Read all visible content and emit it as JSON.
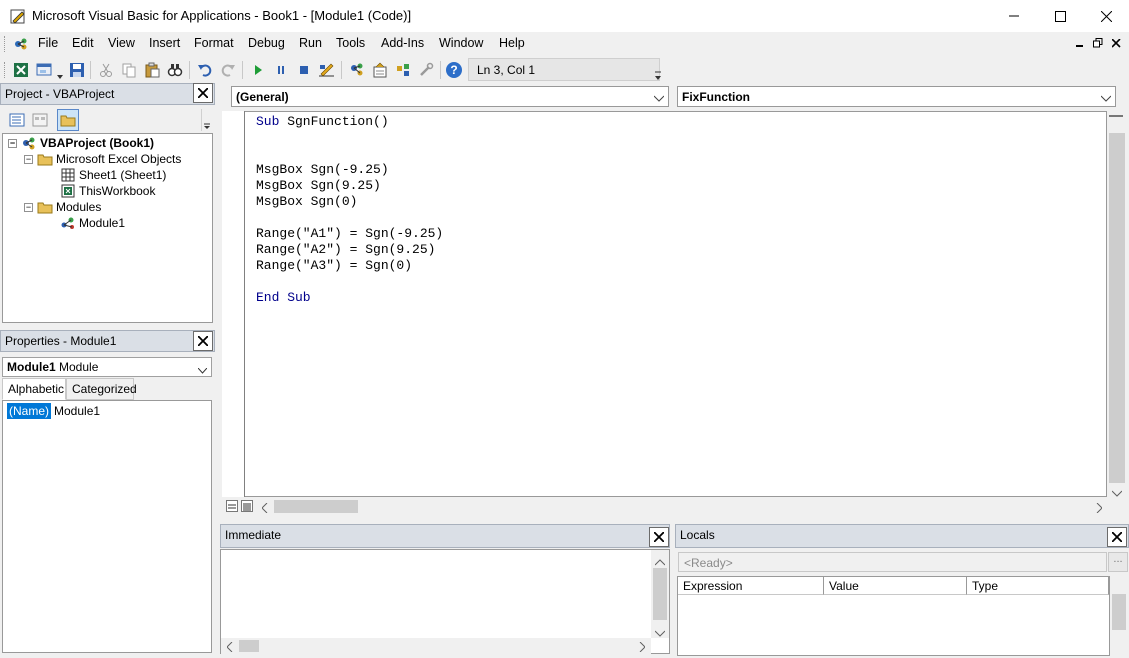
{
  "window": {
    "title": "Microsoft Visual Basic for Applications - Book1 - [Module1 (Code)]"
  },
  "menu": {
    "items": [
      {
        "label": "File"
      },
      {
        "label": "Edit"
      },
      {
        "label": "View"
      },
      {
        "label": "Insert"
      },
      {
        "label": "Format"
      },
      {
        "label": "Debug"
      },
      {
        "label": "Run"
      },
      {
        "label": "Tools"
      },
      {
        "label": "Add-Ins"
      },
      {
        "label": "Window"
      },
      {
        "label": "Help"
      }
    ]
  },
  "toolbar": {
    "line_col": "Ln 3, Col 1"
  },
  "project": {
    "title": "Project - VBAProject",
    "tree": {
      "root": "VBAProject (Book1)",
      "excel_objects": "Microsoft Excel Objects",
      "sheet1": "Sheet1 (Sheet1)",
      "thisworkbook": "ThisWorkbook",
      "modules": "Modules",
      "module1": "Module1"
    }
  },
  "properties": {
    "title": "Properties - Module1",
    "combo_name": "Module1",
    "combo_type": "Module",
    "tabs": {
      "alphabetic": "Alphabetic",
      "categorized": "Categorized"
    },
    "rows": [
      {
        "name": "(Name)",
        "value": "Module1"
      }
    ]
  },
  "code": {
    "object_combo": "(General)",
    "procedure_combo": "FixFunction",
    "lines": [
      {
        "kw": "Sub",
        "rest": " SgnFunction()"
      },
      {
        "kw": "",
        "rest": ""
      },
      {
        "kw": "",
        "rest": ""
      },
      {
        "kw": "",
        "rest": "MsgBox Sgn(-9.25)"
      },
      {
        "kw": "",
        "rest": "MsgBox Sgn(9.25)"
      },
      {
        "kw": "",
        "rest": "MsgBox Sgn(0)"
      },
      {
        "kw": "",
        "rest": ""
      },
      {
        "kw": "",
        "rest": "Range(\"A1\") = Sgn(-9.25)"
      },
      {
        "kw": "",
        "rest": "Range(\"A2\") = Sgn(9.25)"
      },
      {
        "kw": "",
        "rest": "Range(\"A3\") = Sgn(0)"
      },
      {
        "kw": "",
        "rest": ""
      },
      {
        "kw": "End Sub",
        "rest": ""
      }
    ]
  },
  "immediate": {
    "title": "Immediate"
  },
  "locals": {
    "title": "Locals",
    "status": "<Ready>",
    "dots": "...",
    "columns": [
      "Expression",
      "Value",
      "Type"
    ]
  },
  "icons": {
    "colors": {
      "accent": "#0078d7",
      "keyword": "#00008b",
      "run_green": "#1f9d37",
      "panel_title": "#dadfe6"
    }
  }
}
